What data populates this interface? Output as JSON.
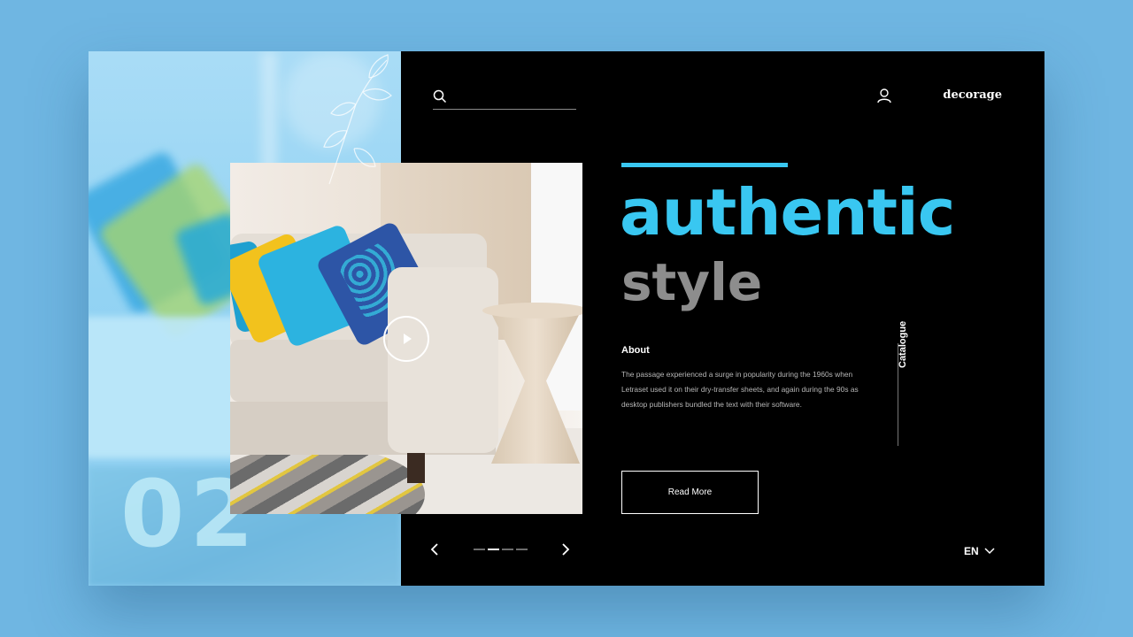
{
  "header": {
    "search_placeholder": "",
    "brand": "decorage"
  },
  "hero": {
    "headline": "authentic",
    "subheadline": "style",
    "slide_number": "02"
  },
  "about": {
    "title": "About",
    "body": "The passage experienced a surge in popularity during the 1960s when Letraset used it on their dry-transfer sheets, and again during the 90s as desktop publishers bundled the text with their software."
  },
  "sidebar": {
    "catalogue_label": "Catalogue"
  },
  "actions": {
    "read_more_label": "Read More"
  },
  "footer": {
    "language": "EN",
    "pagination": {
      "total": 4,
      "active": 2
    }
  },
  "colors": {
    "background": "#6fb6e2",
    "accent": "#39c7f1",
    "panel": "#000000",
    "muted_text": "#8d8d8d"
  },
  "icons": {
    "search": "search-icon",
    "user": "user-icon",
    "play": "play-icon",
    "prev": "chevron-left-icon",
    "next": "chevron-right-icon",
    "dropdown": "chevron-down-icon"
  }
}
